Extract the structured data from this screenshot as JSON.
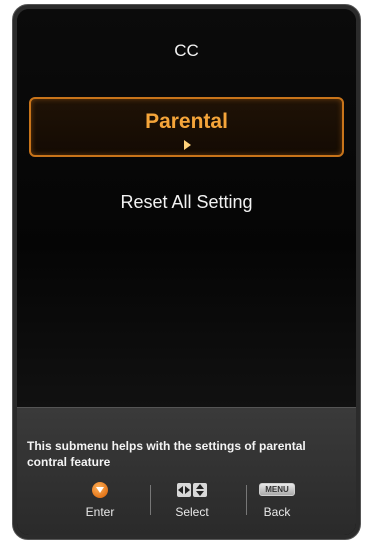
{
  "menu": {
    "items": [
      {
        "label": "CC"
      },
      {
        "label": "Parental"
      },
      {
        "label": "Reset All Setting"
      }
    ]
  },
  "help": {
    "text": "This submenu helps with the settings of parental contral feature"
  },
  "controls": {
    "enter_label": "Enter",
    "select_label": "Select",
    "back_label": "Back",
    "menu_key_text": "MENU"
  },
  "colors": {
    "accent": "#c8741a",
    "selected_text": "#f5a53a"
  }
}
